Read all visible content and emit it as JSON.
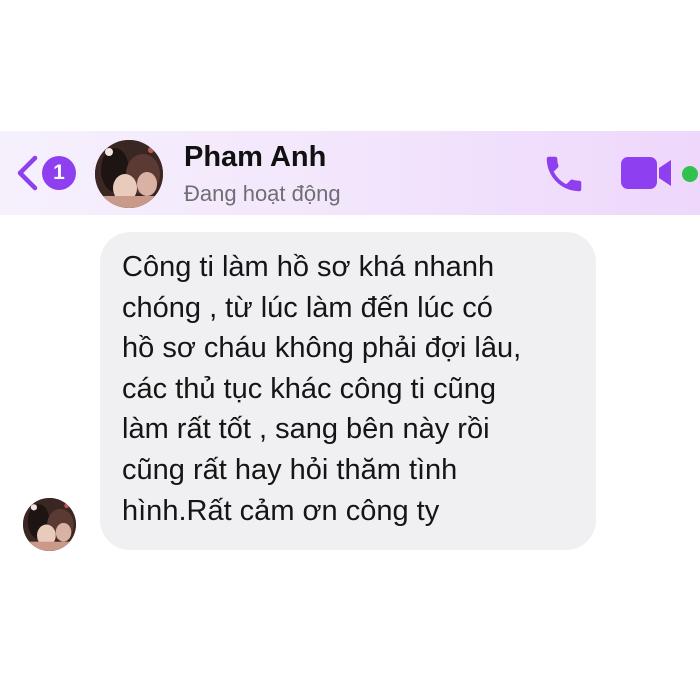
{
  "header": {
    "unread_count": "1",
    "contact_name": "Pham Anh",
    "status": "Đang hoạt động",
    "accent_color": "#8e3ff0",
    "online_color": "#31c24d",
    "icons": {
      "back": "chevron-left-icon",
      "call": "phone-icon",
      "video": "video-camera-icon"
    }
  },
  "conversation": {
    "messages": [
      {
        "sender": "Pham Anh",
        "text": "Công ti làm hồ sơ khá nhanh\nchóng , từ lúc làm đến lúc có\nhồ sơ cháu không phải đợi lâu,\ncác thủ tục khác công ti cũng\nlàm rất tốt , sang bên này rồi\ncũng rất hay hỏi thăm tình\nhình.Rất cảm ơn công ty"
      }
    ]
  }
}
